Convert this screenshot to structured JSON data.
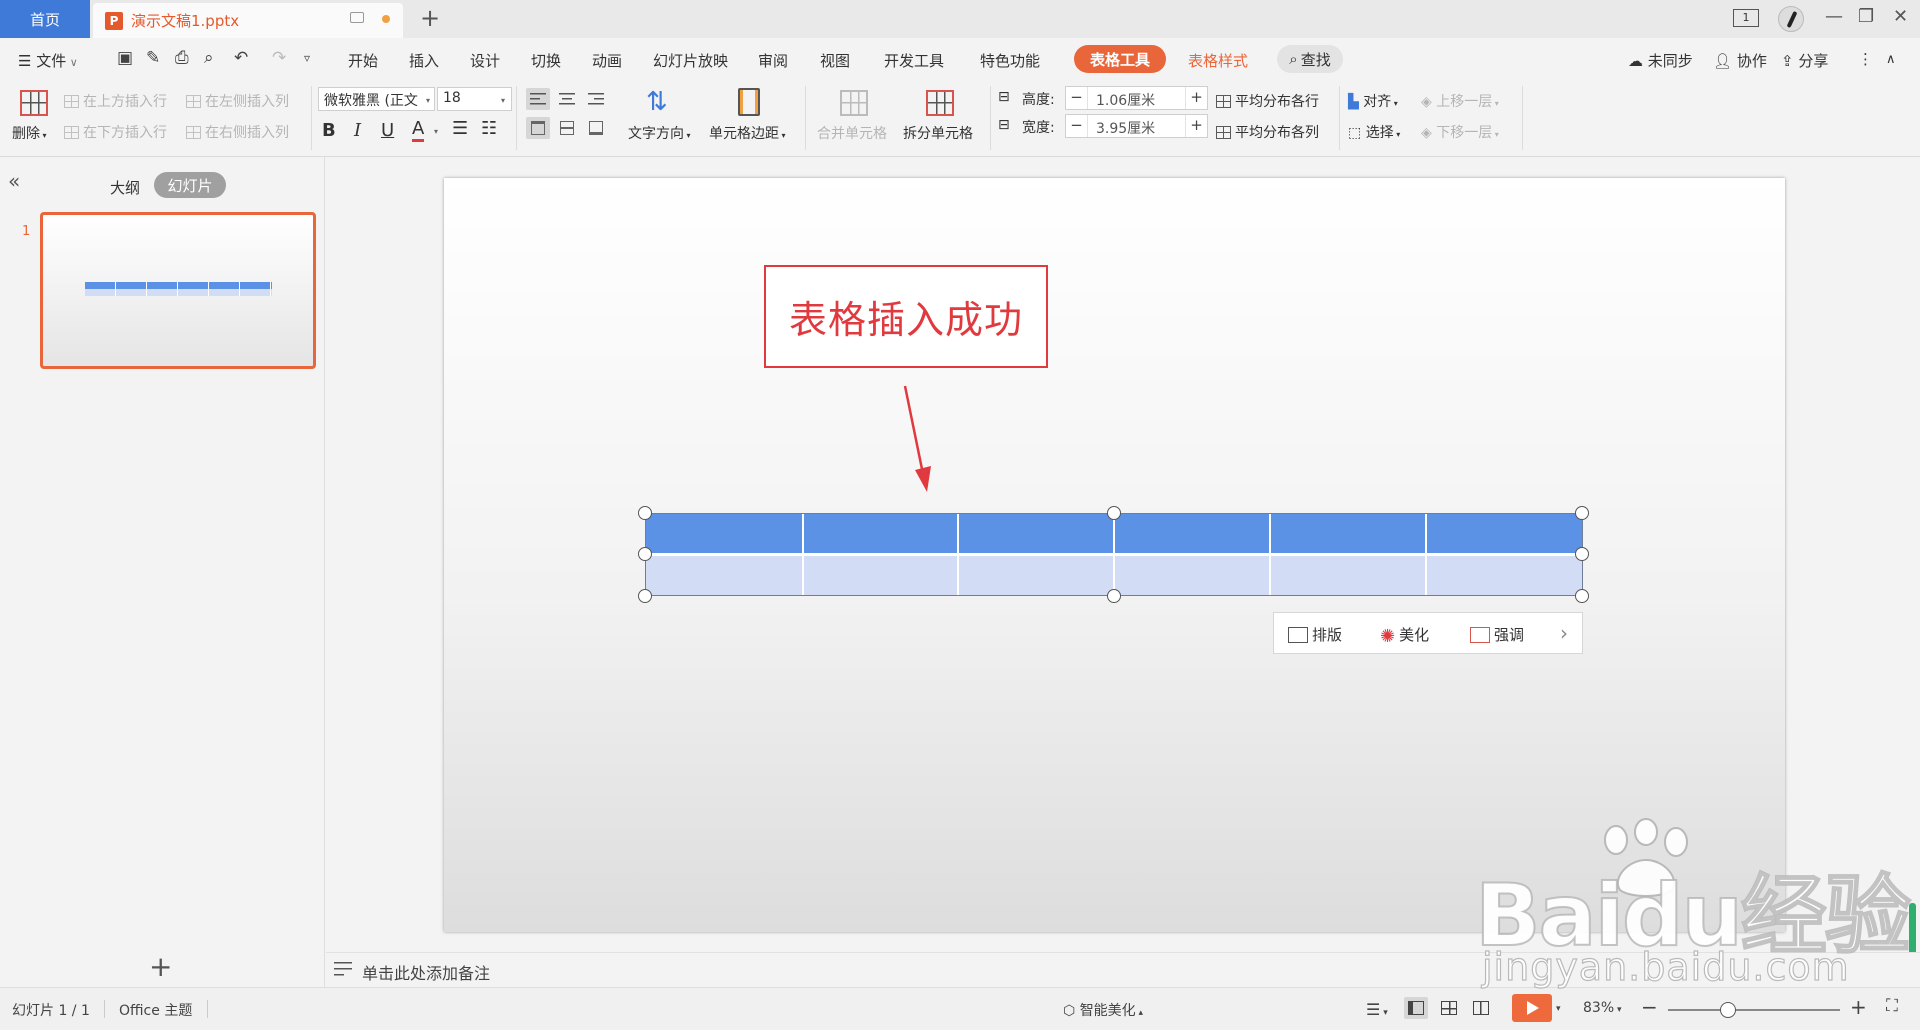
{
  "tabs": {
    "home": "首页",
    "doc_icon": "P",
    "document": "演示文稿1.pptx",
    "add": "+"
  },
  "window": {
    "page_icon": "1",
    "minimize": "—",
    "restore": "❐",
    "close": "✕"
  },
  "menu": {
    "file": "文件",
    "items": [
      "开始",
      "插入",
      "设计",
      "切换",
      "动画",
      "幻灯片放映",
      "审阅",
      "视图",
      "开发工具",
      "特色功能"
    ],
    "table_tools": "表格工具",
    "table_style": "表格样式",
    "find": "查找",
    "sync": "未同步",
    "collab": "协作",
    "share": "分享"
  },
  "ribbon": {
    "delete": "删除",
    "insert_row_above": "在上方插入行",
    "insert_row_below": "在下方插入行",
    "insert_col_left": "在左侧插入列",
    "insert_col_right": "在右侧插入列",
    "font_name": "微软雅黑 (正文",
    "font_size": "18",
    "bold": "B",
    "italic": "I",
    "underline": "U",
    "font_color": "A",
    "text_direction": "文字方向",
    "cell_margin": "单元格边距",
    "merge_cells": "合并单元格",
    "split_cells": "拆分单元格",
    "height_label": "高度:",
    "height_value": "1.06厘米",
    "width_label": "宽度:",
    "width_value": "3.95厘米",
    "spin_minus": "−",
    "spin_plus": "+",
    "distribute_rows": "平均分布各行",
    "distribute_cols": "平均分布各列",
    "align": "对齐",
    "select": "选择",
    "bring_forward": "上移一层",
    "send_backward": "下移一层"
  },
  "left_panel": {
    "outline": "大纲",
    "slides": "幻灯片",
    "slide_number": "1",
    "add": "+"
  },
  "slide": {
    "callout_text": "表格插入成功"
  },
  "table": {
    "rows": 2,
    "cols": 6,
    "header_color": "#5b92e5",
    "band_color": "#d2ddf5"
  },
  "quickbar": {
    "layout": "排版",
    "beautify": "美化",
    "emphasize": "强调"
  },
  "notes": {
    "placeholder": "单击此处添加备注"
  },
  "status": {
    "slide_info": "幻灯片 1 / 1",
    "theme": "Office 主题",
    "smart_beautify": "智能美化",
    "zoom": "83%",
    "zoom_fraction": 0.35
  },
  "watermark": {
    "brand": "Baidu经验",
    "url": "jingyan.baidu.com"
  },
  "colors": {
    "accent": "#e8663a",
    "home_tab": "#3f7ad9",
    "callout": "#e0393e"
  }
}
